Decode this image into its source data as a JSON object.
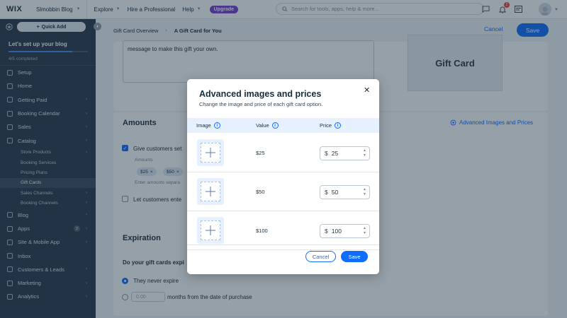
{
  "topbar": {
    "logo": "WIX",
    "site_name": "Slmobbin Blog",
    "nav": [
      "Explore",
      "Hire a Professional",
      "Help"
    ],
    "upgrade_label": "Upgrade",
    "search_placeholder": "Search for tools, apps, help & more...",
    "notifications_count": "2"
  },
  "sidebar": {
    "quick_add_label": "Quick Add",
    "setup_title": "Let's set up your blog",
    "setup_progress_fraction": 0.8,
    "setup_count": "4/5 completed",
    "items_top": [
      {
        "label": "Setup",
        "arrow": false
      },
      {
        "label": "Home",
        "arrow": false
      },
      {
        "label": "Getting Paid",
        "arrow": true
      },
      {
        "label": "Booking Calendar",
        "arrow": true
      },
      {
        "label": "Sales",
        "arrow": true
      },
      {
        "label": "Catalog",
        "arrow": true
      }
    ],
    "sub_items": [
      {
        "label": "Store Products",
        "arrow": true
      },
      {
        "label": "Booking Services",
        "arrow": false
      },
      {
        "label": "Pricing Plans",
        "arrow": false
      },
      {
        "label": "Gift Cards",
        "arrow": false
      },
      {
        "label": "Sales Channels",
        "arrow": true
      },
      {
        "label": "Booking Channels",
        "arrow": true
      }
    ],
    "items_bottom": [
      {
        "label": "Blog",
        "arrow": true
      },
      {
        "label": "Apps",
        "arrow": true,
        "badge": "2"
      },
      {
        "label": "Site & Mobile App",
        "arrow": true
      },
      {
        "label": "Inbox",
        "arrow": false
      },
      {
        "label": "Customers & Leads",
        "arrow": true
      },
      {
        "label": "Marketing",
        "arrow": true
      },
      {
        "label": "Analytics",
        "arrow": true
      }
    ]
  },
  "content": {
    "breadcrumb": [
      "Gift Card Overview",
      "A Gift Card for You"
    ],
    "cancel_label": "Cancel",
    "save_label": "Save",
    "message_text": "message to make this gift your own.",
    "gift_card_preview": "Gift Card",
    "amounts_title": "Amounts",
    "advanced_link": "Advanced Images and Prices",
    "give_customers_label": "Give customers set",
    "amounts_label": "Amounts",
    "chips": [
      "$25",
      "$50"
    ],
    "enter_amounts_label": "Enter amounts separa",
    "let_customers_label": "Let customers ente",
    "expiration_title": "Expiration",
    "expire_question": "Do your gift cards expi",
    "never_expire_label": "They never expire",
    "months_placeholder": "0.00",
    "months_label": "months from the date of purchase"
  },
  "modal": {
    "title": "Advanced images and prices",
    "subtitle": "Change the image and price of each gift card option.",
    "columns": [
      "Image",
      "Value",
      "Price"
    ],
    "rows": [
      {
        "value": "$25",
        "currency": "$",
        "price": "25"
      },
      {
        "value": "$50",
        "currency": "$",
        "price": "50"
      },
      {
        "value": "$100",
        "currency": "$",
        "price": "100"
      }
    ],
    "cancel_label": "Cancel",
    "save_label": "Save"
  },
  "colors": {
    "accent": "#116dff",
    "sidebar_bg": "#2b3a4a",
    "upgrade": "#7b3fd0"
  }
}
